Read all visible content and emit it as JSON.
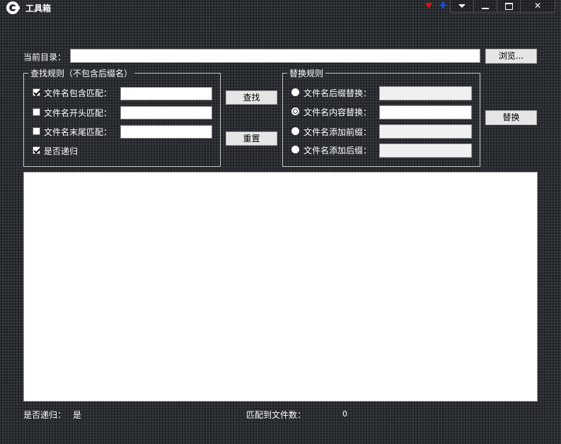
{
  "window": {
    "title": "工具箱"
  },
  "title_controls": {
    "minimize": "–",
    "maximize": "□",
    "close": "✕",
    "menu": "▼"
  },
  "current_dir": {
    "label": "当前目录：",
    "value": "",
    "browse_label": "浏览..."
  },
  "find_rules": {
    "title": "查找规则（不包含后缀名）",
    "items": [
      {
        "label": "文件名包含匹配：",
        "checked": true,
        "value": ""
      },
      {
        "label": "文件名开头匹配：",
        "checked": false,
        "value": ""
      },
      {
        "label": "文件名末尾匹配：",
        "checked": false,
        "value": ""
      }
    ],
    "recursive": {
      "label": "是否递归",
      "checked": true
    },
    "find_label": "查找",
    "reset_label": "重置"
  },
  "replace_rules": {
    "title": "替换规则",
    "items": [
      {
        "label": "文件名后缀替换：",
        "selected": false,
        "value": "",
        "enabled": false
      },
      {
        "label": "文件名内容替换：",
        "selected": true,
        "value": "",
        "enabled": true
      },
      {
        "label": "文件名添加前缀：",
        "selected": false,
        "value": "",
        "enabled": false
      },
      {
        "label": "文件名添加后缀：",
        "selected": false,
        "value": "",
        "enabled": false
      }
    ],
    "replace_label": "替换"
  },
  "status": {
    "recursive_label": "是否递归：",
    "recursive_value": "是",
    "match_count_label": "匹配到文件数：",
    "match_count_value": "0"
  },
  "colors": {
    "accent_red": "#e01010",
    "accent_blue": "#1a4ee0",
    "background": "#2b2e32"
  }
}
